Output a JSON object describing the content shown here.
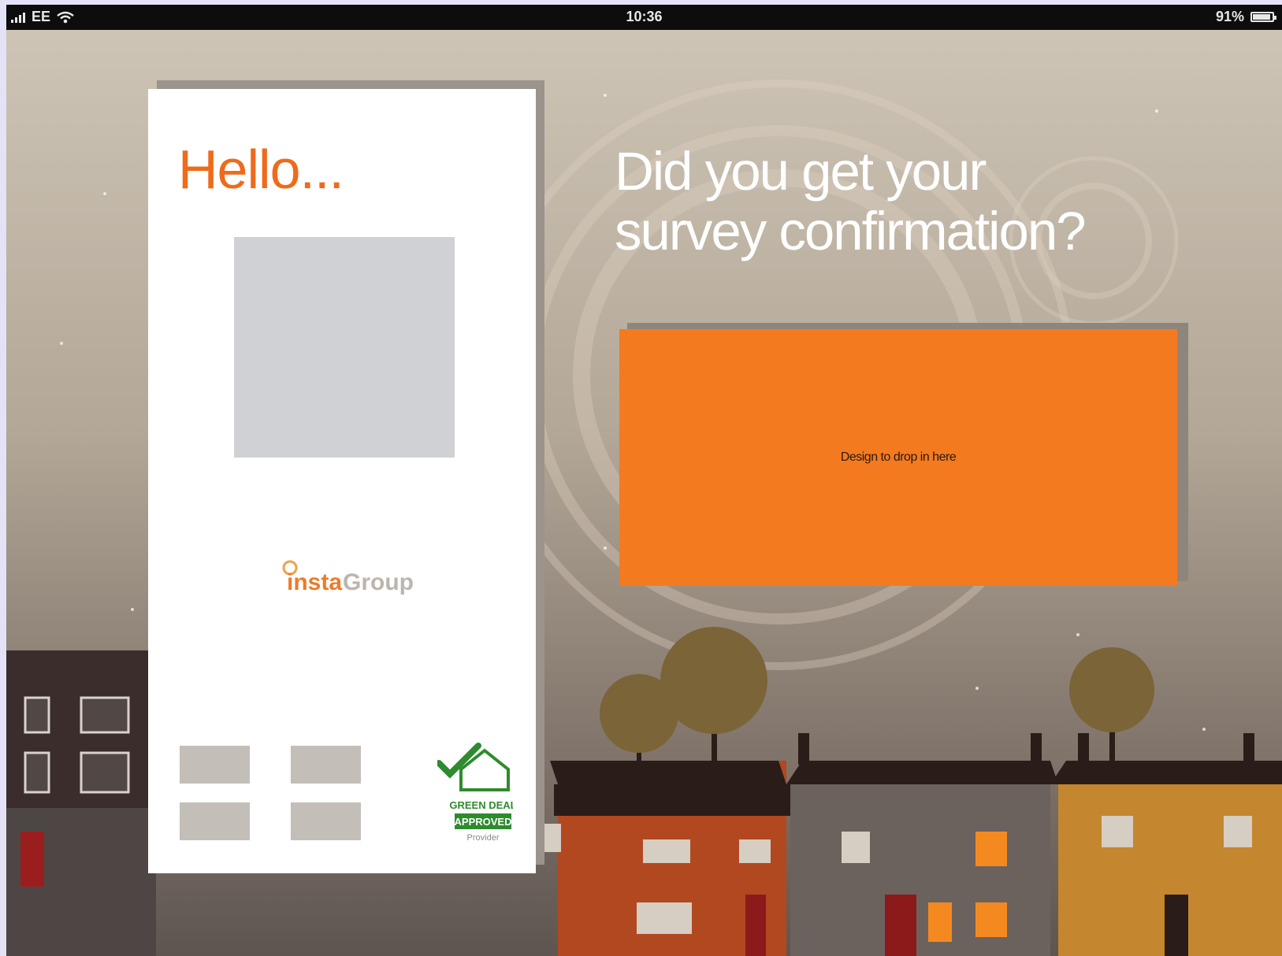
{
  "status_bar": {
    "carrier": "EE",
    "time": "10:36",
    "battery": "91%"
  },
  "left_card": {
    "greeting": "Hello...",
    "logo": {
      "part1": "insta",
      "part2": "Group"
    },
    "badge": {
      "line1": "GREEN DEAL",
      "line2": "APPROVED",
      "line3": "Provider"
    }
  },
  "headline": {
    "line1": "Did you get your",
    "line2": "survey confirmation?"
  },
  "content_panel": {
    "placeholder_text": "Design to drop in here"
  },
  "colors": {
    "accent_orange": "#f47a20",
    "greeting_orange": "#ee6b1c",
    "badge_green": "#2e8b2e"
  }
}
